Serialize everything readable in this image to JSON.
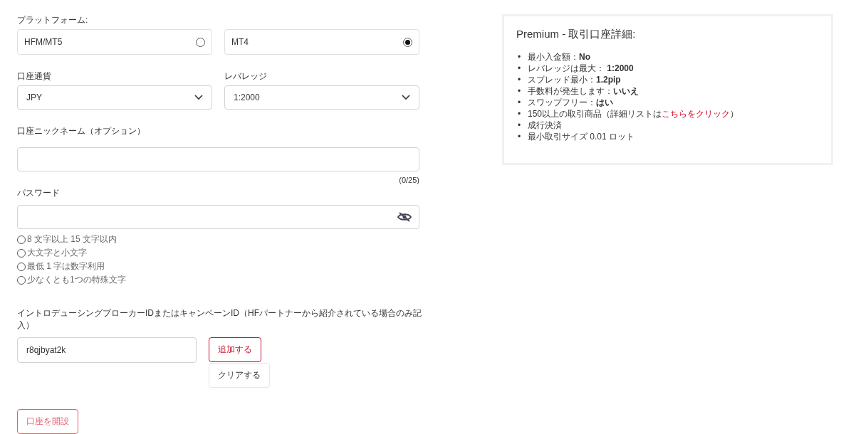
{
  "platform": {
    "label": "プラットフォーム:",
    "options": [
      {
        "label": "HFM/MT5",
        "selected": false
      },
      {
        "label": "MT4",
        "selected": true
      }
    ]
  },
  "currency": {
    "label": "口座通貨",
    "value": "JPY"
  },
  "leverage": {
    "label": "レバレッジ",
    "value": "1:2000"
  },
  "nickname": {
    "label": "口座ニックネーム（オプション）",
    "counter": "(0/25)"
  },
  "password": {
    "label": "パスワード",
    "rules": [
      {
        "text": "8 文字以上 15 文字以内",
        "met": false
      },
      {
        "text": "大文字と小文字",
        "met": false
      },
      {
        "text": "最低 1 字は数字利用",
        "met": false
      },
      {
        "text": "少なくとも1つの特殊文字",
        "met": false
      }
    ]
  },
  "referral": {
    "label": "イントロデューシングブローカーIDまたはキャンペーンID（HFパートナーから紹介されている場合のみ記入）",
    "value": "r8qjbyat2k",
    "add_button": "追加する",
    "clear_button": "クリアする"
  },
  "submit_button": "口座を開設",
  "details": {
    "title": "Premium - 取引口座詳細:",
    "items": [
      {
        "kind": "text",
        "bullet": "•",
        "text": "最小入金額：**No**"
      },
      {
        "kind": "text",
        "bullet": "•",
        "text": "レバレッジは最大： **1:2000**"
      },
      {
        "kind": "text",
        "bullet": "•",
        "text": "スプレッド最小：**1.2pip**"
      },
      {
        "kind": "text",
        "bullet": "•",
        "text": "手数料が発生します：**いいえ**"
      },
      {
        "kind": "text",
        "bullet": "•",
        "text": "スワップフリー：**はい**"
      },
      {
        "kind": "link",
        "bullet": "•",
        "before": "150以上の取引商品（詳細リストは",
        "link": "こちらをクリック",
        "after": "）"
      },
      {
        "kind": "text",
        "bullet": "•",
        "text": "成行決済"
      },
      {
        "kind": "text",
        "bullet": "•",
        "text": "最小取引サイズ 0.01 ロット"
      }
    ]
  }
}
